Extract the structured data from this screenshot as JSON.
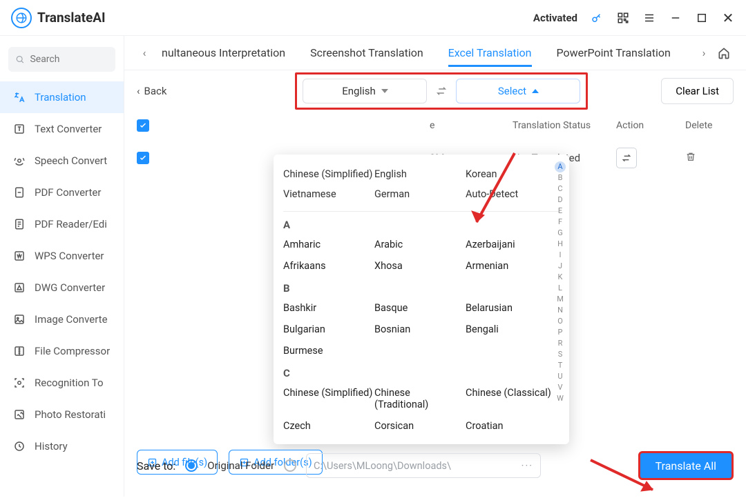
{
  "brand": "TranslateAI",
  "titlebar": {
    "activated": "Activated"
  },
  "search": {
    "placeholder": "Search"
  },
  "sidebar": {
    "items": [
      {
        "label": "Translation",
        "icon": "translation-icon",
        "active": true
      },
      {
        "label": "Text Converter",
        "icon": "text-icon"
      },
      {
        "label": "Speech Convert",
        "icon": "speech-icon"
      },
      {
        "label": "PDF Converter",
        "icon": "pdf-icon"
      },
      {
        "label": "PDF Reader/Edi",
        "icon": "pdf-reader-icon"
      },
      {
        "label": "WPS Converter",
        "icon": "wps-icon"
      },
      {
        "label": "DWG Converter",
        "icon": "dwg-icon"
      },
      {
        "label": "Image Converte",
        "icon": "image-icon"
      },
      {
        "label": "File Compressor",
        "icon": "compress-icon"
      },
      {
        "label": "Recognition To",
        "icon": "ocr-icon"
      },
      {
        "label": "Photo Restorati",
        "icon": "photo-icon"
      },
      {
        "label": "History",
        "icon": "history-icon"
      }
    ]
  },
  "tabs": {
    "items": [
      {
        "label": "nultaneous Interpretation"
      },
      {
        "label": "Screenshot Translation"
      },
      {
        "label": "Excel Translation",
        "active": true
      },
      {
        "label": "PowerPoint Translation"
      }
    ]
  },
  "toolbar": {
    "back": "Back",
    "source_lang": "English",
    "target_lang": "Select",
    "clear": "Clear List"
  },
  "table": {
    "headers": {
      "size": "e",
      "status": "Translation Status",
      "action": "Action",
      "delete": "Delete"
    },
    "rows": [
      {
        "size": "3M",
        "status": "Not Translated"
      }
    ]
  },
  "dropdown": {
    "top": [
      "Chinese (Simplified)",
      "English",
      "Korean",
      "Vietnamese",
      "German",
      "Auto-Detect"
    ],
    "groups": [
      {
        "letter": "A",
        "items": [
          "Amharic",
          "Arabic",
          "Azerbaijani",
          "Afrikaans",
          "Xhosa",
          "Armenian"
        ]
      },
      {
        "letter": "B",
        "items": [
          "Bashkir",
          "Basque",
          "Belarusian",
          "Bulgarian",
          "Bosnian",
          "Bengali",
          "Burmese",
          "",
          ""
        ]
      },
      {
        "letter": "C",
        "items": [
          "Chinese (Simplified)",
          "Chinese (Traditional)",
          "Chinese (Classical)",
          "Czech",
          "Corsican",
          "Croatian"
        ]
      }
    ],
    "alpha": [
      "A",
      "B",
      "C",
      "D",
      "E",
      "F",
      "G",
      "H",
      "I",
      "J",
      "K",
      "L",
      "M",
      "N",
      "O",
      "P",
      "R",
      "S",
      "T",
      "U",
      "V",
      "W"
    ]
  },
  "add": {
    "files": "Add file(s)",
    "folders": "Add folder(s)"
  },
  "save": {
    "label": "Save to:",
    "opt1": "Original Folder",
    "path": "C:\\Users\\MLoong\\Downloads\\"
  },
  "translate_all": "Translate All"
}
